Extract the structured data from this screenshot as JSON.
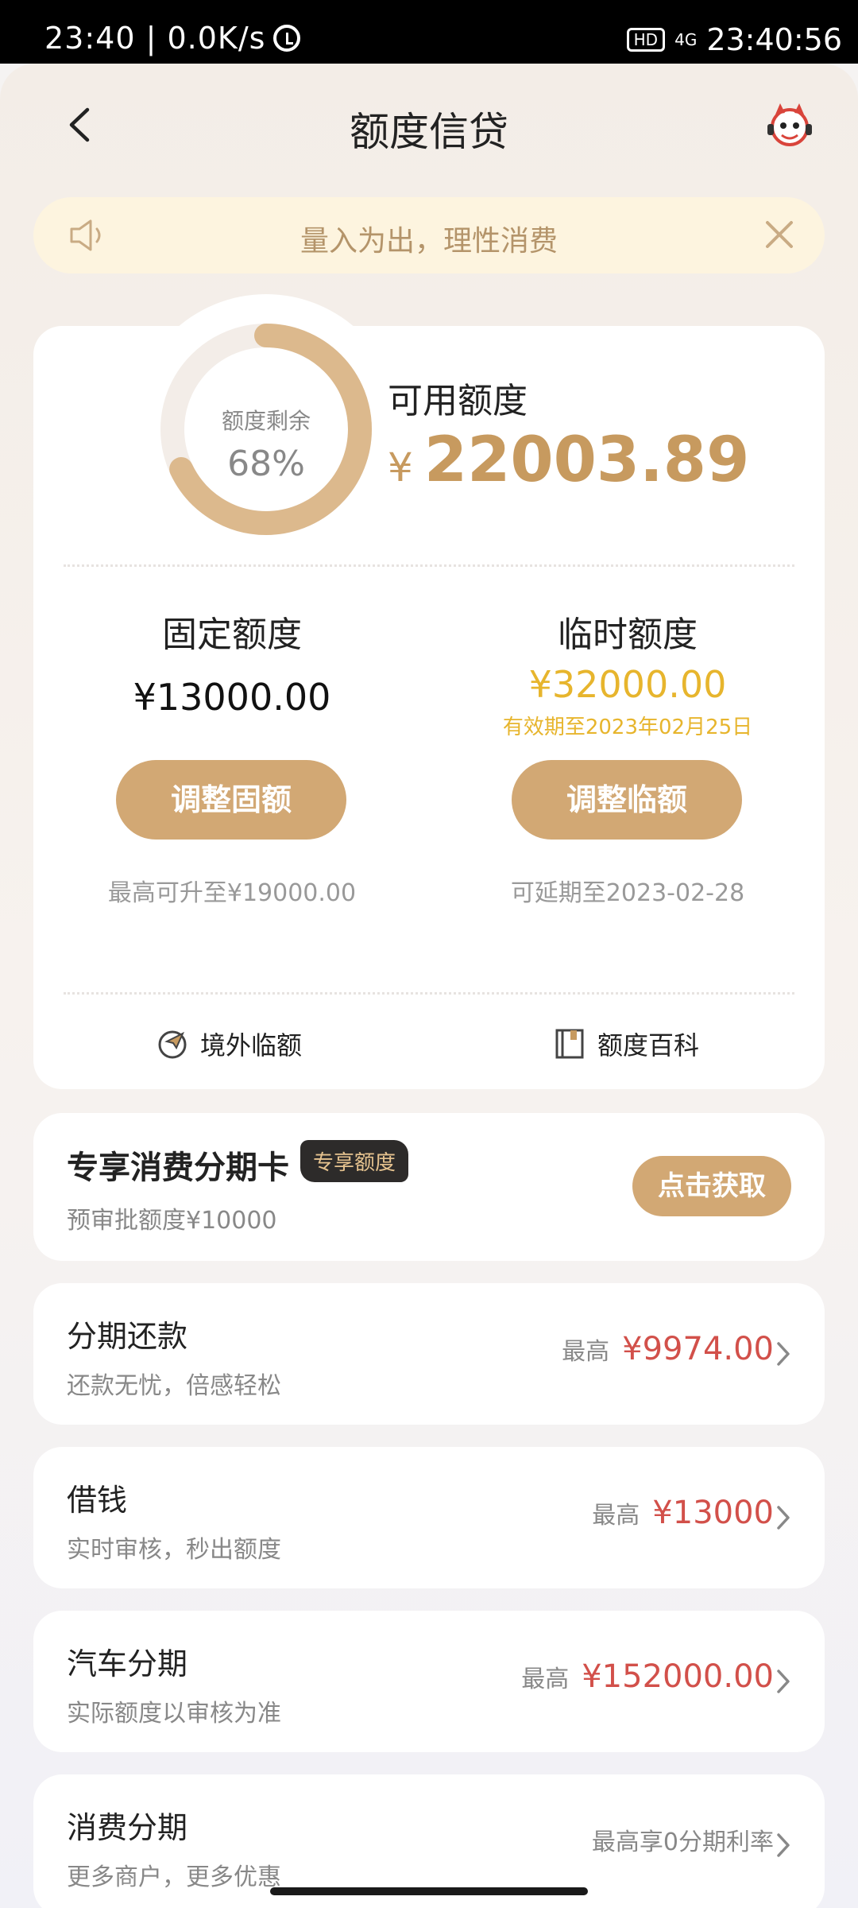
{
  "status_bar": {
    "time_speed": "23:40 | 0.0K/s",
    "hd": "HD",
    "network": "4G",
    "clock_right": "23:40:56"
  },
  "nav": {
    "title": "额度信贷",
    "back_icon": "back-arrow-icon",
    "service_icon": "mascot-icon"
  },
  "notice": {
    "text": "量入为出，理性消费",
    "icon": "speaker-icon"
  },
  "credit": {
    "ring_label": "额度剩余",
    "ring_percent": "68%",
    "ring_fraction": 0.68,
    "available_label": "可用额度",
    "currency": "¥",
    "available_amount": "22003.89",
    "fixed": {
      "title": "固定额度",
      "amount": "¥13000.00",
      "button": "调整固额",
      "note_prefix": "最高可升至",
      "note_amount": "¥19000.00"
    },
    "temporary": {
      "title": "临时额度",
      "amount": "¥32000.00",
      "valid": "有效期至2023年02月25日",
      "button": "调整临额",
      "note": "可延期至2023-02-28"
    },
    "links": {
      "overseas": "境外临额",
      "wiki": "额度百科"
    }
  },
  "promo": {
    "title": "专享消费分期卡",
    "badge": "专享额度",
    "subtitle": "预审批额度¥10000",
    "button": "点击获取"
  },
  "list": [
    {
      "title": "分期还款",
      "subtitle": "还款无忧，倍感轻松",
      "prefix": "最高",
      "amount": "¥9974.00"
    },
    {
      "title": "借钱",
      "subtitle": "实时审核，秒出额度",
      "prefix": "最高",
      "amount": "¥13000"
    },
    {
      "title": "汽车分期",
      "subtitle": "实际额度以审核为准",
      "prefix": "最高",
      "amount": "¥152000.00"
    },
    {
      "title": "消费分期",
      "subtitle": "更多商户，更多优惠",
      "plain": "最高享0分期利率"
    }
  ],
  "colors": {
    "accent_gold": "#d2a874",
    "amount_gold": "#c79a5f",
    "temp_yellow": "#e7b52d",
    "amount_red": "#d2504a"
  }
}
